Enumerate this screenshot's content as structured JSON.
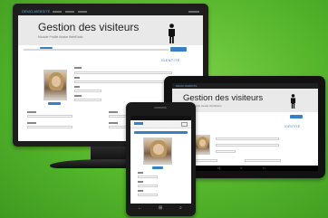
{
  "app": {
    "brand": "DEMO-WEBSITE",
    "title": "Gestion des visiteurs",
    "subtitle": "Module Profile Avatar WebRatio"
  },
  "profile": {
    "section_label": "IDENTITÉ"
  },
  "colors": {
    "background": "#55b52b",
    "accent": "#3a7fc4"
  },
  "icons": {
    "person": "person-silhouette-icon"
  }
}
